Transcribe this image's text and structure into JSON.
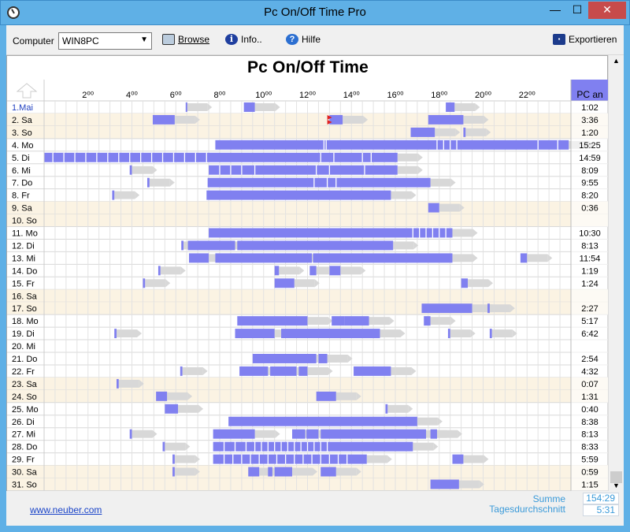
{
  "window": {
    "title": "Pc On/Off Time Pro",
    "min": "—",
    "max": "☐",
    "close": "✕"
  },
  "toolbar": {
    "computer_label": "Computer",
    "computer_value": "WIN8PC",
    "browse": "Browse",
    "info": "Info..",
    "help": "Hilfe",
    "export": "Exportieren"
  },
  "heading": "Pc On/Off Time",
  "column_header": "PC an",
  "hours": [
    "2⁰⁰",
    "4⁰⁰",
    "6⁰⁰",
    "8⁰⁰",
    "10⁰⁰",
    "12⁰⁰",
    "14⁰⁰",
    "16⁰⁰",
    "18⁰⁰",
    "20⁰⁰",
    "22⁰⁰"
  ],
  "colors": {
    "on": "#8080f0",
    "weekend": "#fbf3e3",
    "off_tail": "#d8d8d8",
    "flag": "#e02020"
  },
  "rows": [
    {
      "label": "1.Mai",
      "total": "1:02",
      "weekend": false,
      "blue": true,
      "segs": [
        [
          6.45,
          6.5
        ],
        [
          9.1,
          9.6
        ],
        [
          18.3,
          18.7
        ]
      ]
    },
    {
      "label": "2. Sa",
      "total": "3:36",
      "weekend": true,
      "segs": [
        [
          4.95,
          5.95
        ],
        [
          13.0,
          13.6
        ],
        [
          17.5,
          19.1
        ]
      ],
      "flag": 12.9
    },
    {
      "label": "3. So",
      "total": "1:20",
      "weekend": true,
      "segs": [
        [
          16.7,
          17.8
        ],
        [
          19.1,
          19.2
        ]
      ]
    },
    {
      "label": "4. Mo",
      "total": "15:25",
      "weekend": false,
      "segs": [
        [
          7.8,
          23.9
        ]
      ],
      "gaps": [
        12.75,
        12.85,
        17.9,
        18.2,
        18.5,
        18.8,
        22.5,
        23.4
      ]
    },
    {
      "label": "5. Di",
      "total": "14:59",
      "weekend": false,
      "segs": [
        [
          0,
          16.1
        ]
      ],
      "gaps": [
        0.4,
        0.9,
        1.4,
        1.9,
        2.4,
        2.9,
        3.4,
        3.9,
        4.4,
        4.9,
        5.4,
        5.9,
        6.4,
        6.9,
        7.4,
        12.6,
        13.2,
        14.5,
        14.9
      ]
    },
    {
      "label": "6. Mi",
      "total": "8:09",
      "weekend": false,
      "segs": [
        [
          3.9,
          4.0
        ],
        [
          7.5,
          16.1
        ]
      ],
      "gaps": [
        8.0,
        8.5,
        9.0,
        9.6,
        12.4,
        13.0,
        14.6
      ]
    },
    {
      "label": "7. Do",
      "total": "9:55",
      "weekend": false,
      "segs": [
        [
          4.7,
          4.8
        ],
        [
          7.45,
          17.6
        ]
      ],
      "gaps": [
        12.3,
        12.9,
        13.3
      ]
    },
    {
      "label": "8. Fr",
      "total": "8:20",
      "weekend": false,
      "segs": [
        [
          3.1,
          3.2
        ],
        [
          7.4,
          15.8
        ]
      ]
    },
    {
      "label": "9. Sa",
      "total": "0:36",
      "weekend": true,
      "segs": [
        [
          17.5,
          18.0
        ]
      ]
    },
    {
      "label": "10. So",
      "total": "",
      "weekend": true,
      "segs": []
    },
    {
      "label": "11. Mo",
      "total": "10:30",
      "weekend": false,
      "segs": [
        [
          7.5,
          18.6
        ]
      ],
      "gaps": [
        16.8,
        17.1,
        17.4,
        17.7,
        18.0,
        18.3
      ]
    },
    {
      "label": "12. Di",
      "total": "8:13",
      "weekend": false,
      "segs": [
        [
          6.25,
          6.35
        ],
        [
          6.55,
          8.7
        ],
        [
          8.8,
          15.9
        ]
      ]
    },
    {
      "label": "13. Mi",
      "total": "11:54",
      "weekend": false,
      "segs": [
        [
          6.6,
          7.5
        ],
        [
          7.8,
          12.2
        ],
        [
          12.25,
          18.6
        ],
        [
          21.7,
          22.0
        ]
      ]
    },
    {
      "label": "14. Do",
      "total": "1:19",
      "weekend": false,
      "segs": [
        [
          5.2,
          5.3
        ],
        [
          10.5,
          10.7
        ],
        [
          12.1,
          12.4
        ],
        [
          13.0,
          13.5
        ]
      ]
    },
    {
      "label": "15. Fr",
      "total": "1:24",
      "weekend": false,
      "segs": [
        [
          4.5,
          4.6
        ],
        [
          10.5,
          11.4
        ],
        [
          19.0,
          19.3
        ]
      ]
    },
    {
      "label": "16. Sa",
      "total": "",
      "weekend": true,
      "segs": []
    },
    {
      "label": "17. So",
      "total": "2:27",
      "weekend": true,
      "segs": [
        [
          17.2,
          19.5
        ],
        [
          20.2,
          20.3
        ]
      ]
    },
    {
      "label": "18. Mo",
      "total": "5:17",
      "weekend": false,
      "segs": [
        [
          8.8,
          12.0
        ],
        [
          13.1,
          13.7
        ],
        [
          13.7,
          14.8
        ],
        [
          17.3,
          17.6
        ]
      ]
    },
    {
      "label": "19. Di",
      "total": "6:42",
      "weekend": false,
      "segs": [
        [
          3.2,
          3.3
        ],
        [
          8.7,
          10.5
        ],
        [
          10.8,
          15.3
        ],
        [
          18.4,
          18.5
        ],
        [
          20.3,
          20.4
        ]
      ]
    },
    {
      "label": "20. Mi",
      "total": "",
      "weekend": false,
      "segs": []
    },
    {
      "label": "21. Do",
      "total": "2:54",
      "weekend": false,
      "segs": [
        [
          9.5,
          12.4
        ],
        [
          12.5,
          12.9
        ]
      ]
    },
    {
      "label": "22. Fr",
      "total": "4:32",
      "weekend": false,
      "segs": [
        [
          6.2,
          6.3
        ],
        [
          8.9,
          10.2
        ],
        [
          10.3,
          11.5
        ],
        [
          11.6,
          12.0
        ],
        [
          14.1,
          15.8
        ]
      ]
    },
    {
      "label": "23. Sa",
      "total": "0:07",
      "weekend": true,
      "segs": [
        [
          3.3,
          3.4
        ]
      ]
    },
    {
      "label": "24. So",
      "total": "1:31",
      "weekend": true,
      "segs": [
        [
          5.1,
          5.6
        ],
        [
          12.4,
          13.3
        ]
      ]
    },
    {
      "label": "25. Mo",
      "total": "0:40",
      "weekend": false,
      "segs": [
        [
          5.5,
          6.1
        ],
        [
          15.55,
          15.65
        ]
      ]
    },
    {
      "label": "26. Di",
      "total": "8:38",
      "weekend": false,
      "segs": [
        [
          8.4,
          17.0
        ]
      ]
    },
    {
      "label": "27. Mi",
      "total": "8:13",
      "weekend": false,
      "segs": [
        [
          3.9,
          4.0
        ],
        [
          7.7,
          9.6
        ],
        [
          11.3,
          11.9
        ],
        [
          11.95,
          12.5
        ],
        [
          12.6,
          17.4
        ],
        [
          17.6,
          17.9
        ]
      ]
    },
    {
      "label": "28. Do",
      "total": "8:33",
      "weekend": false,
      "segs": [
        [
          5.4,
          5.5
        ],
        [
          7.7,
          16.8
        ]
      ],
      "gaps": [
        8.2,
        8.7,
        9.2,
        9.6,
        9.9,
        10.2,
        10.5,
        10.8,
        11.1,
        11.4,
        11.7,
        12.0,
        12.3,
        12.6,
        12.9
      ]
    },
    {
      "label": "29. Fr",
      "total": "5:59",
      "weekend": false,
      "segs": [
        [
          5.85,
          5.95
        ],
        [
          7.7,
          14.7
        ],
        [
          18.6,
          19.1
        ]
      ],
      "gaps": [
        8.2,
        8.6,
        9.0,
        9.4,
        9.8,
        10.2,
        10.6,
        11.0,
        11.4,
        11.8,
        12.2,
        12.6,
        13.0,
        13.4,
        13.8
      ]
    },
    {
      "label": "30. Sa",
      "total": "0:59",
      "weekend": true,
      "segs": [
        [
          5.85,
          5.95
        ],
        [
          9.3,
          9.8
        ],
        [
          10.2,
          10.4
        ],
        [
          10.5,
          11.3
        ],
        [
          12.6,
          13.3
        ]
      ]
    },
    {
      "label": "31. So",
      "total": "1:15",
      "weekend": true,
      "segs": [
        [
          17.6,
          18.9
        ]
      ]
    }
  ],
  "footer": {
    "link": "www.neuber.com",
    "sum_label": "Summe",
    "sum_value": "154:29",
    "avg_label": "Tagesdurchschnitt",
    "avg_value": "5:31"
  }
}
